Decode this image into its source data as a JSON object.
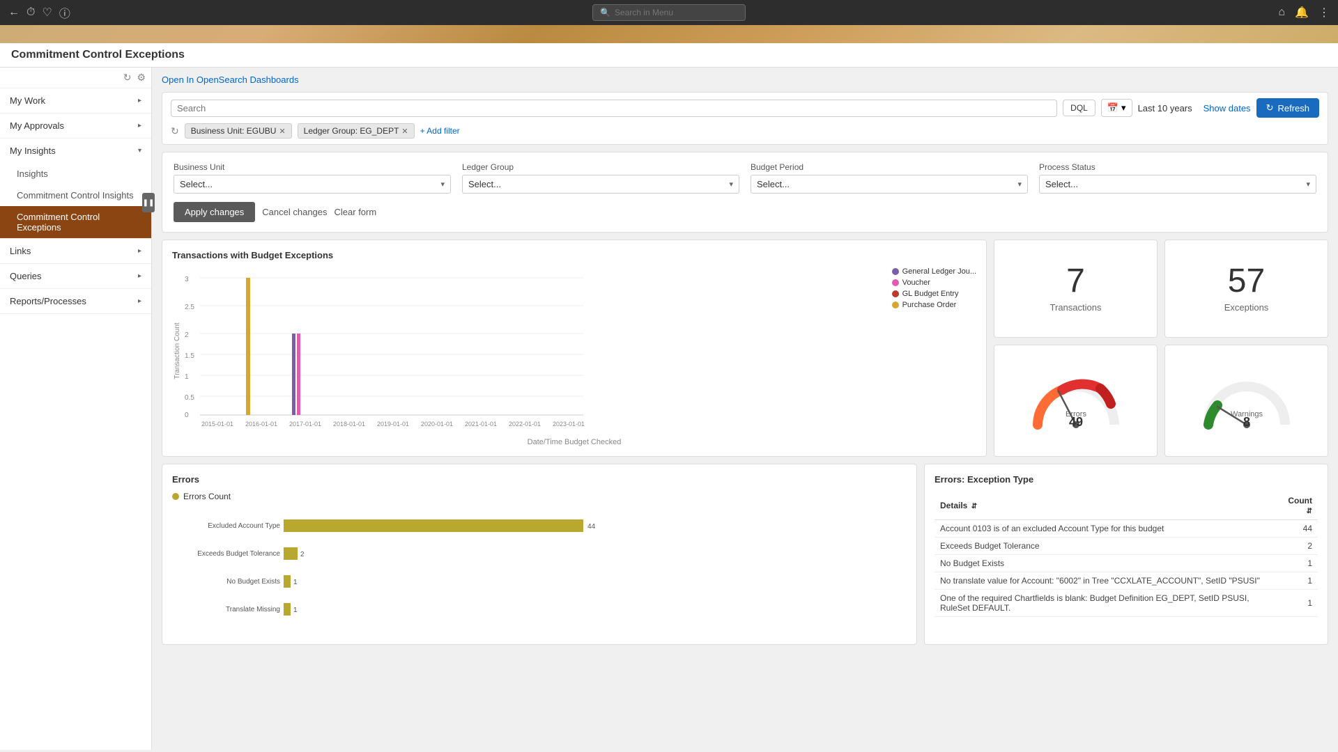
{
  "topNav": {
    "searchPlaceholder": "Search in Menu",
    "icons": [
      "back-icon",
      "clock-icon",
      "heart-icon",
      "info-icon",
      "home-icon",
      "bell-icon",
      "more-icon"
    ]
  },
  "pageTitle": "Commitment Control Exceptions",
  "sidebar": {
    "topIcons": [
      "refresh-icon",
      "settings-icon"
    ],
    "sections": [
      {
        "id": "my-work",
        "label": "My Work",
        "expanded": false,
        "items": []
      },
      {
        "id": "my-approvals",
        "label": "My Approvals",
        "expanded": false,
        "items": []
      },
      {
        "id": "my-insights",
        "label": "My Insights",
        "expanded": true,
        "items": [
          {
            "id": "insights",
            "label": "Insights",
            "active": false
          },
          {
            "id": "commitment-control-insights",
            "label": "Commitment Control Insights",
            "active": false
          },
          {
            "id": "commitment-control-exceptions",
            "label": "Commitment Control Exceptions",
            "active": true
          }
        ]
      },
      {
        "id": "links",
        "label": "Links",
        "expanded": false,
        "items": []
      },
      {
        "id": "queries",
        "label": "Queries",
        "expanded": false,
        "items": []
      },
      {
        "id": "reports-processes",
        "label": "Reports/Processes",
        "expanded": false,
        "items": []
      }
    ]
  },
  "content": {
    "openSearchLink": "Open In OpenSearch Dashboards",
    "filterBar": {
      "searchPlaceholder": "Search",
      "dqlLabel": "DQL",
      "periodLabel": "Last 10 years",
      "showDatesLabel": "Show dates",
      "refreshLabel": "Refresh",
      "tags": [
        {
          "label": "Business Unit: EGUBU"
        },
        {
          "label": "Ledger Group: EG_DEPT"
        }
      ],
      "addFilterLabel": "+ Add filter"
    },
    "formFilters": {
      "fields": [
        {
          "id": "business-unit",
          "label": "Business Unit",
          "placeholder": "Select..."
        },
        {
          "id": "ledger-group",
          "label": "Ledger Group",
          "placeholder": "Select..."
        },
        {
          "id": "budget-period",
          "label": "Budget Period",
          "placeholder": "Select..."
        },
        {
          "id": "process-status",
          "label": "Process Status",
          "placeholder": "Select..."
        }
      ],
      "applyLabel": "Apply changes",
      "cancelLabel": "Cancel changes",
      "clearLabel": "Clear form"
    },
    "transactionsChart": {
      "title": "Transactions with Budget Exceptions",
      "yAxisLabel": "Transaction Count",
      "xAxisLabel": "Date/Time Budget Checked",
      "legend": [
        {
          "label": "General Ledger Jou...",
          "color": "#7b5ea7"
        },
        {
          "label": "Voucher",
          "color": "#e05cb0"
        },
        {
          "label": "GL Budget Entry",
          "color": "#c0392b"
        },
        {
          "label": "Purchase Order",
          "color": "#d4a830"
        }
      ],
      "xLabels": [
        "2015-01-01",
        "2016-01-01",
        "2017-01-01",
        "2018-01-01",
        "2019-01-01",
        "2020-01-01",
        "2021-01-01",
        "2022-01-01",
        "2023-01-01"
      ],
      "yMax": 3,
      "bars": [
        {
          "x": "2016-01-01",
          "value": 3,
          "color": "#d4a830"
        },
        {
          "x": "2017-01-01",
          "value": 2,
          "color": "#7b5ea7"
        },
        {
          "x": "2017-01-01",
          "value": 2,
          "color": "#e05cb0"
        }
      ]
    },
    "stats": {
      "transactions": {
        "value": "7",
        "label": "Transactions"
      },
      "exceptions": {
        "value": "57",
        "label": "Exceptions"
      },
      "errors": {
        "value": "49",
        "label": "Errors"
      },
      "warnings": {
        "value": "8",
        "label": "Warnings"
      }
    },
    "errorsChart": {
      "title": "Errors",
      "legendLabel": "Errors Count",
      "bars": [
        {
          "label": "Excluded Account Type",
          "value": 44,
          "maxValue": 44
        },
        {
          "label": "Exceeds Budget Tolerance",
          "value": 2,
          "maxValue": 44
        },
        {
          "label": "No Budget Exists",
          "value": 1,
          "maxValue": 44
        },
        {
          "label": "Translate Missing",
          "value": 1,
          "maxValue": 44
        }
      ]
    },
    "exceptionsTable": {
      "title": "Errors: Exception Type",
      "columns": [
        {
          "label": "Details",
          "sortable": true
        },
        {
          "label": "Count",
          "sortable": true
        }
      ],
      "rows": [
        {
          "detail": "Account 0103 is of an excluded Account Type for this budget",
          "count": "44"
        },
        {
          "detail": "Exceeds Budget Tolerance",
          "count": "2"
        },
        {
          "detail": "No Budget Exists",
          "count": "1"
        },
        {
          "detail": "No translate value for Account: \"6002\" in Tree \"CCXLATE_ACCOUNT\", SetID \"PSUSI\"",
          "count": "1"
        },
        {
          "detail": "One of the required Chartfields is blank: Budget Definition EG_DEPT, SetID PSUSI, RuleSet DEFAULT.",
          "count": "1"
        }
      ]
    }
  }
}
